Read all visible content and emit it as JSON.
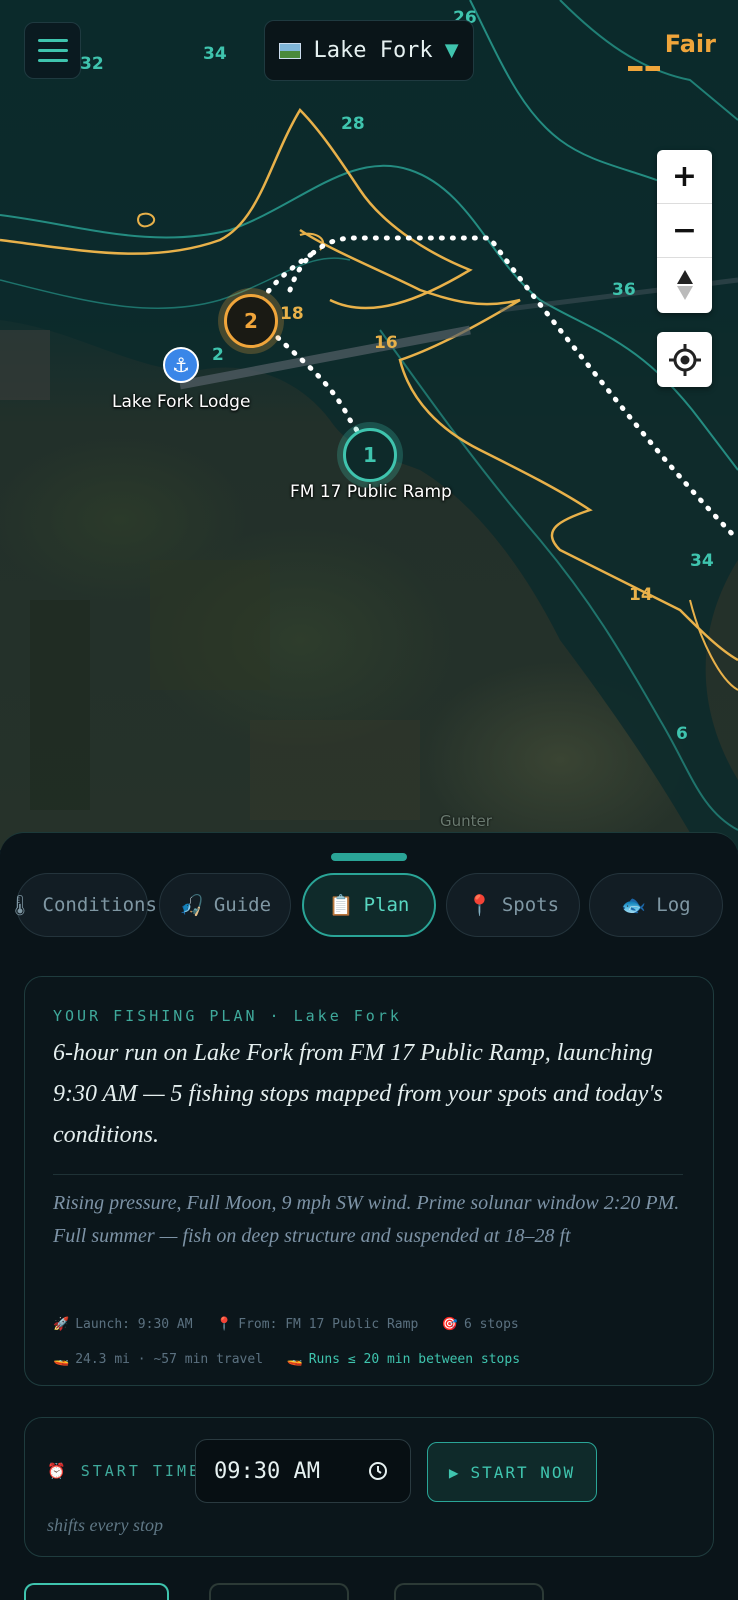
{
  "header": {
    "lake_name": "Lake Fork",
    "rating": "Fair"
  },
  "map": {
    "depth_labels": [
      "26",
      "32",
      "34",
      "28",
      "36",
      "18",
      "2",
      "16",
      "34",
      "14",
      "6"
    ],
    "stops": [
      {
        "number": "1",
        "name": "FM 17 Public Ramp"
      },
      {
        "number": "2",
        "name": ""
      }
    ],
    "poi": {
      "name": "Lake Fork Lodge"
    },
    "town": "Gunter",
    "controls": {
      "zoom_in": "+",
      "zoom_out": "−",
      "compass": "▲"
    }
  },
  "tabs": [
    {
      "label": "Conditions",
      "icon": "thermometer-icon",
      "active": false
    },
    {
      "label": "Guide",
      "icon": "angler-icon",
      "active": false
    },
    {
      "label": "Plan",
      "icon": "clipboard-icon",
      "active": true
    },
    {
      "label": "Spots",
      "icon": "pin-icon",
      "active": false
    },
    {
      "label": "Log",
      "icon": "bass-icon",
      "active": false
    }
  ],
  "plan": {
    "kicker": "YOUR FISHING PLAN · Lake Fork",
    "headline": "6-hour run on Lake Fork from FM 17 Public Ramp, launching 9:30 AM — 5 fishing stops mapped from your spots and today's conditions.",
    "subtext": "Rising pressure, Full Moon, 9 mph SW wind. Prime solunar window 2:20 PM. Full summer — fish on deep structure and suspended at 18–28 ft",
    "meta_launch": "Launch: 9:30 AM",
    "meta_from": "From: FM 17 Public Ramp",
    "meta_stops": "6 stops",
    "meta_distance": "24.3 mi · ~57 min travel",
    "meta_runs": "Runs ≤ 20 min between stops"
  },
  "start_time": {
    "label": "START TIME",
    "value": "09:30 AM",
    "start_now": "START NOW",
    "note": "shifts every stop"
  },
  "colors": {
    "accent": "#3fc4ae",
    "gold": "#f0a53b",
    "background": "#0a1419"
  }
}
